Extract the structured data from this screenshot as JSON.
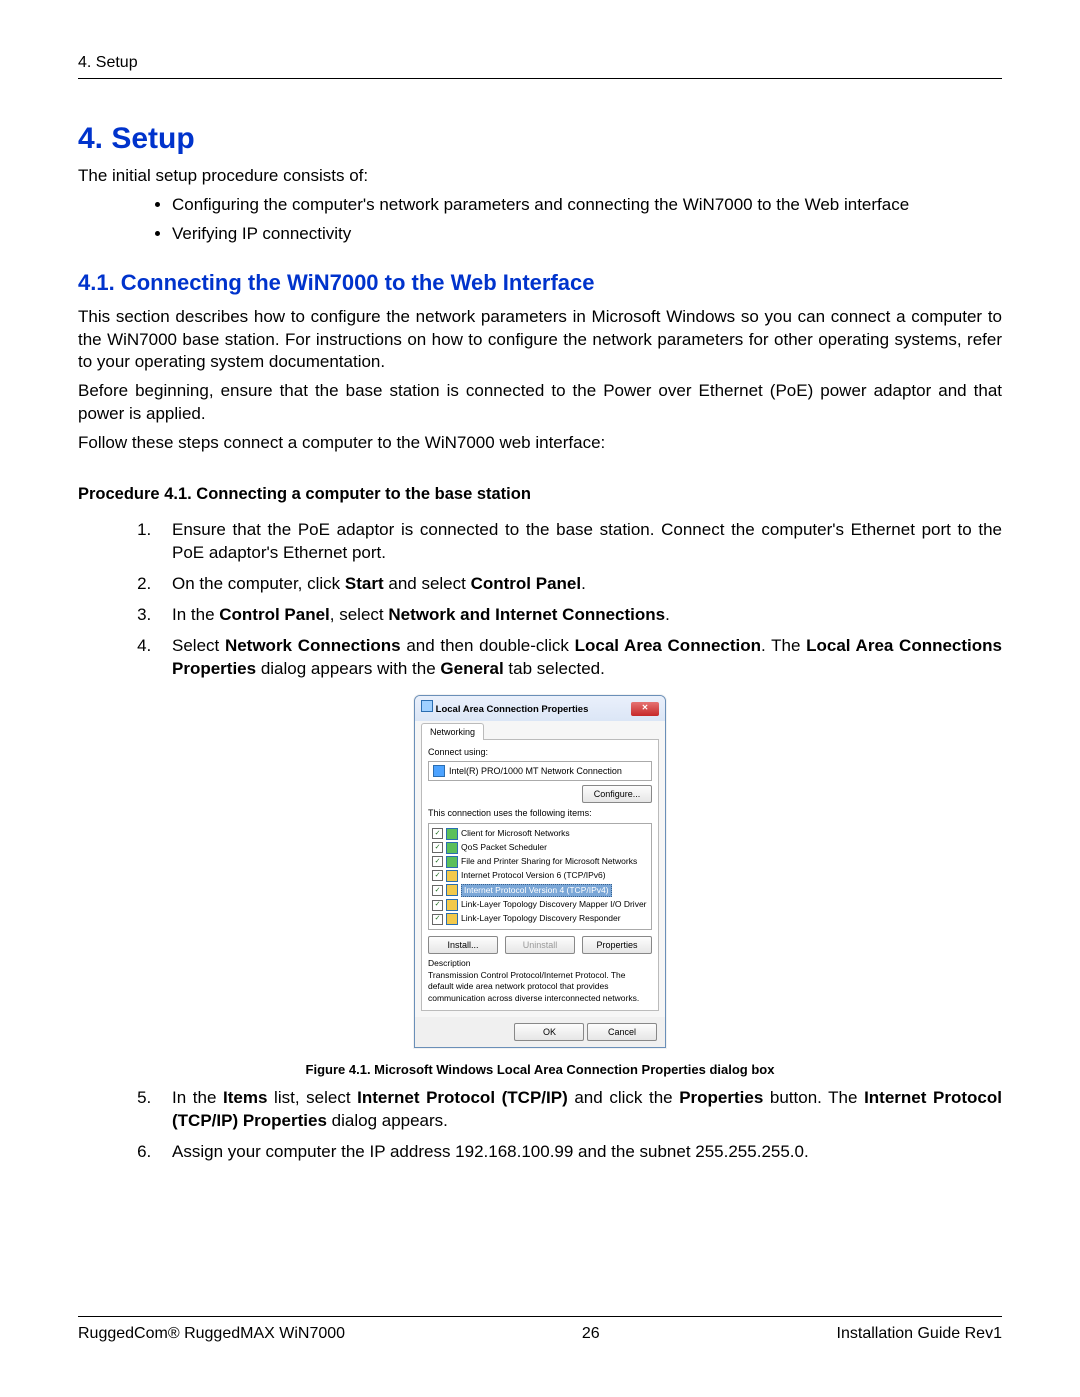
{
  "header": {
    "breadcrumb": "4. Setup"
  },
  "h1": "4. Setup",
  "intro": "The initial setup procedure consists of:",
  "bullets": [
    "Configuring the computer's network parameters and connecting the WiN7000 to the Web interface",
    "Verifying IP connectivity"
  ],
  "h2": "4.1. Connecting the WiN7000 to the Web Interface",
  "p1": "This section describes how to configure the network parameters in Microsoft Windows so you can connect a computer to the WiN7000 base station. For instructions on how to configure the network parameters for other operating systems, refer to your operating system documentation.",
  "p2": "Before beginning, ensure that the base station is connected to the Power over Ethernet (PoE) power adaptor and that power is applied.",
  "p3": "Follow these steps connect a computer to the WiN7000 web interface:",
  "procTitle": "Procedure 4.1. Connecting a computer to the base station",
  "step1": "Ensure that the PoE adaptor is connected to the base station. Connect the computer's Ethernet port to the PoE adaptor's Ethernet port.",
  "step2_a": "On the computer, click ",
  "step2_b1": "Start",
  "step2_c": " and select ",
  "step2_b2": "Control Panel",
  "step2_d": ".",
  "step3_a": "In the ",
  "step3_b1": "Control Panel",
  "step3_c": ", select ",
  "step3_b2": "Network and Internet Connections",
  "step3_d": ".",
  "step4_a": "Select ",
  "step4_b1": "Network Connections",
  "step4_c": " and then double-click ",
  "step4_b2": "Local Area Connection",
  "step4_d": ". The ",
  "step4_b3": "Local Area Connections Properties",
  "step4_e": " dialog appears with the ",
  "step4_b4": "General",
  "step4_f": " tab selected.",
  "figCaption": "Figure 4.1. Microsoft Windows Local Area Connection Properties dialog box",
  "step5_a": "In the ",
  "step5_b1": "Items",
  "step5_c": " list, select ",
  "step5_b2": "Internet Protocol (TCP/IP)",
  "step5_d": " and click the ",
  "step5_b3": "Properties",
  "step5_e": " button. The ",
  "step5_b4": "Internet Protocol (TCP/IP) Properties",
  "step5_f": " dialog appears.",
  "step6": "Assign your computer the IP address 192.168.100.99 and the subnet 255.255.255.0.",
  "footer": {
    "left": "RuggedCom® RuggedMAX WiN7000",
    "center": "26",
    "right": "Installation Guide Rev1"
  },
  "dialog": {
    "title": "Local Area Connection Properties",
    "tab": "Networking",
    "connectUsingLabel": "Connect using:",
    "adapter": "Intel(R) PRO/1000 MT Network Connection",
    "configureBtn": "Configure...",
    "itemsLabel": "This connection uses the following items:",
    "items": [
      "Client for Microsoft Networks",
      "QoS Packet Scheduler",
      "File and Printer Sharing for Microsoft Networks",
      "Internet Protocol Version 6 (TCP/IPv6)",
      "Internet Protocol Version 4 (TCP/IPv4)",
      "Link-Layer Topology Discovery Mapper I/O Driver",
      "Link-Layer Topology Discovery Responder"
    ],
    "installBtn": "Install...",
    "uninstallBtn": "Uninstall",
    "propertiesBtn": "Properties",
    "descLabel": "Description",
    "descText": "Transmission Control Protocol/Internet Protocol. The default wide area network protocol that provides communication across diverse interconnected networks.",
    "okBtn": "OK",
    "cancelBtn": "Cancel"
  }
}
